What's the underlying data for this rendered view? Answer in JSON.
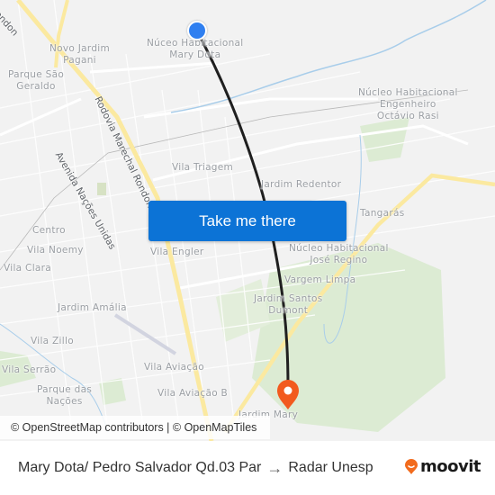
{
  "map": {
    "places": [
      {
        "name": "place-nucleo-mary-dota",
        "lines": [
          "Núceo Habitacional",
          "Mary Dota"
        ]
      },
      {
        "name": "place-novo-jardim-pagani",
        "lines": [
          "Novo Jardim",
          "Pagani"
        ]
      },
      {
        "name": "place-parque-sao-geraldo",
        "lines": [
          "Parque São",
          "Geraldo"
        ]
      },
      {
        "name": "place-nucleo-octavio-rasi",
        "lines": [
          "Núcleo Habitacional",
          "Engenheiro",
          "Octávio Rasi"
        ]
      },
      {
        "name": "place-vila-triagem",
        "lines": [
          "Vila Triagem"
        ]
      },
      {
        "name": "place-jardim-redentor",
        "lines": [
          "Jardim Redentor"
        ]
      },
      {
        "name": "place-tangaras",
        "lines": [
          "Tangarás"
        ]
      },
      {
        "name": "place-centro",
        "lines": [
          "Centro"
        ]
      },
      {
        "name": "place-vila-noemy",
        "lines": [
          "Vila Noemy"
        ]
      },
      {
        "name": "place-vila-clara",
        "lines": [
          "Vila Clara"
        ]
      },
      {
        "name": "place-vila-engler",
        "lines": [
          "Vila Engler"
        ]
      },
      {
        "name": "place-nucleo-jose-regino",
        "lines": [
          "Núcleo Habitacional",
          "José Regino"
        ]
      },
      {
        "name": "place-vargem-limpa",
        "lines": [
          "Vargem Limpa"
        ]
      },
      {
        "name": "place-jardim-santos-dumont",
        "lines": [
          "Jardim Santos",
          "Dumont"
        ]
      },
      {
        "name": "place-jardim-amalia",
        "lines": [
          "Jardim Amália"
        ]
      },
      {
        "name": "place-vila-zillo",
        "lines": [
          "Vila Zillo"
        ]
      },
      {
        "name": "place-vila-serrao",
        "lines": [
          "Vila Serrão"
        ]
      },
      {
        "name": "place-parque-das-nacoes",
        "lines": [
          "Parque das",
          "Nações"
        ]
      },
      {
        "name": "place-vila-aviacao",
        "lines": [
          "Vila Aviação"
        ]
      },
      {
        "name": "place-vila-aviacao-b",
        "lines": [
          "Vila Aviação B"
        ]
      },
      {
        "name": "place-jardim-mary",
        "lines": [
          "Jardim Mary"
        ]
      }
    ],
    "roads": {
      "rondon_top": "ondon",
      "rodovia_marechal_rondon": "Rodovia Marechal Rondon",
      "avenida_nacoes_unidas": "Avenida Nações Unidas"
    },
    "colors": {
      "route": "#1f1f1f",
      "origin": "#2f7ff0",
      "destination": "#f25a1e",
      "highway": "#fbe9a0",
      "park": "#dcebd3",
      "water": "#a8cdea"
    }
  },
  "cta": {
    "label": "Take me there"
  },
  "attribution": "© OpenStreetMap contributors | © OpenMapTiles",
  "footer": {
    "origin": "Mary Dota/ Pedro Salvador Qd.03 Par",
    "arrow": "→",
    "destination": "Radar Unesp"
  },
  "brand": {
    "name": "moovit",
    "color": "#f26b1d"
  }
}
